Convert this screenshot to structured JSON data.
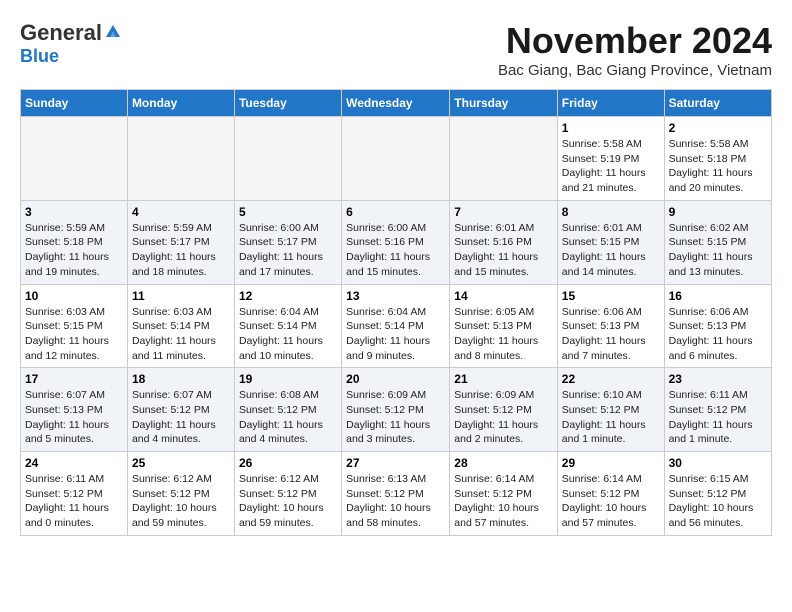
{
  "logo": {
    "general": "General",
    "blue": "Blue"
  },
  "title": "November 2024",
  "location": "Bac Giang, Bac Giang Province, Vietnam",
  "days_of_week": [
    "Sunday",
    "Monday",
    "Tuesday",
    "Wednesday",
    "Thursday",
    "Friday",
    "Saturday"
  ],
  "weeks": [
    [
      {
        "day": "",
        "info": ""
      },
      {
        "day": "",
        "info": ""
      },
      {
        "day": "",
        "info": ""
      },
      {
        "day": "",
        "info": ""
      },
      {
        "day": "",
        "info": ""
      },
      {
        "day": "1",
        "info": "Sunrise: 5:58 AM\nSunset: 5:19 PM\nDaylight: 11 hours and 21 minutes."
      },
      {
        "day": "2",
        "info": "Sunrise: 5:58 AM\nSunset: 5:18 PM\nDaylight: 11 hours and 20 minutes."
      }
    ],
    [
      {
        "day": "3",
        "info": "Sunrise: 5:59 AM\nSunset: 5:18 PM\nDaylight: 11 hours and 19 minutes."
      },
      {
        "day": "4",
        "info": "Sunrise: 5:59 AM\nSunset: 5:17 PM\nDaylight: 11 hours and 18 minutes."
      },
      {
        "day": "5",
        "info": "Sunrise: 6:00 AM\nSunset: 5:17 PM\nDaylight: 11 hours and 17 minutes."
      },
      {
        "day": "6",
        "info": "Sunrise: 6:00 AM\nSunset: 5:16 PM\nDaylight: 11 hours and 15 minutes."
      },
      {
        "day": "7",
        "info": "Sunrise: 6:01 AM\nSunset: 5:16 PM\nDaylight: 11 hours and 15 minutes."
      },
      {
        "day": "8",
        "info": "Sunrise: 6:01 AM\nSunset: 5:15 PM\nDaylight: 11 hours and 14 minutes."
      },
      {
        "day": "9",
        "info": "Sunrise: 6:02 AM\nSunset: 5:15 PM\nDaylight: 11 hours and 13 minutes."
      }
    ],
    [
      {
        "day": "10",
        "info": "Sunrise: 6:03 AM\nSunset: 5:15 PM\nDaylight: 11 hours and 12 minutes."
      },
      {
        "day": "11",
        "info": "Sunrise: 6:03 AM\nSunset: 5:14 PM\nDaylight: 11 hours and 11 minutes."
      },
      {
        "day": "12",
        "info": "Sunrise: 6:04 AM\nSunset: 5:14 PM\nDaylight: 11 hours and 10 minutes."
      },
      {
        "day": "13",
        "info": "Sunrise: 6:04 AM\nSunset: 5:14 PM\nDaylight: 11 hours and 9 minutes."
      },
      {
        "day": "14",
        "info": "Sunrise: 6:05 AM\nSunset: 5:13 PM\nDaylight: 11 hours and 8 minutes."
      },
      {
        "day": "15",
        "info": "Sunrise: 6:06 AM\nSunset: 5:13 PM\nDaylight: 11 hours and 7 minutes."
      },
      {
        "day": "16",
        "info": "Sunrise: 6:06 AM\nSunset: 5:13 PM\nDaylight: 11 hours and 6 minutes."
      }
    ],
    [
      {
        "day": "17",
        "info": "Sunrise: 6:07 AM\nSunset: 5:13 PM\nDaylight: 11 hours and 5 minutes."
      },
      {
        "day": "18",
        "info": "Sunrise: 6:07 AM\nSunset: 5:12 PM\nDaylight: 11 hours and 4 minutes."
      },
      {
        "day": "19",
        "info": "Sunrise: 6:08 AM\nSunset: 5:12 PM\nDaylight: 11 hours and 4 minutes."
      },
      {
        "day": "20",
        "info": "Sunrise: 6:09 AM\nSunset: 5:12 PM\nDaylight: 11 hours and 3 minutes."
      },
      {
        "day": "21",
        "info": "Sunrise: 6:09 AM\nSunset: 5:12 PM\nDaylight: 11 hours and 2 minutes."
      },
      {
        "day": "22",
        "info": "Sunrise: 6:10 AM\nSunset: 5:12 PM\nDaylight: 11 hours and 1 minute."
      },
      {
        "day": "23",
        "info": "Sunrise: 6:11 AM\nSunset: 5:12 PM\nDaylight: 11 hours and 1 minute."
      }
    ],
    [
      {
        "day": "24",
        "info": "Sunrise: 6:11 AM\nSunset: 5:12 PM\nDaylight: 11 hours and 0 minutes."
      },
      {
        "day": "25",
        "info": "Sunrise: 6:12 AM\nSunset: 5:12 PM\nDaylight: 10 hours and 59 minutes."
      },
      {
        "day": "26",
        "info": "Sunrise: 6:12 AM\nSunset: 5:12 PM\nDaylight: 10 hours and 59 minutes."
      },
      {
        "day": "27",
        "info": "Sunrise: 6:13 AM\nSunset: 5:12 PM\nDaylight: 10 hours and 58 minutes."
      },
      {
        "day": "28",
        "info": "Sunrise: 6:14 AM\nSunset: 5:12 PM\nDaylight: 10 hours and 57 minutes."
      },
      {
        "day": "29",
        "info": "Sunrise: 6:14 AM\nSunset: 5:12 PM\nDaylight: 10 hours and 57 minutes."
      },
      {
        "day": "30",
        "info": "Sunrise: 6:15 AM\nSunset: 5:12 PM\nDaylight: 10 hours and 56 minutes."
      }
    ]
  ]
}
